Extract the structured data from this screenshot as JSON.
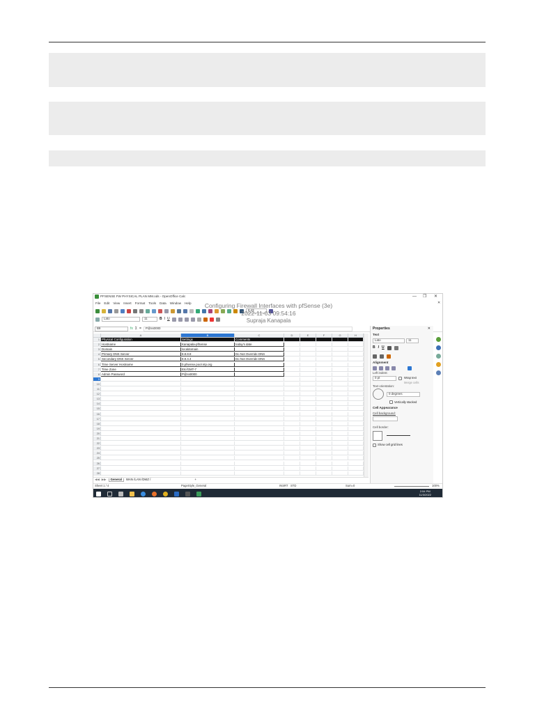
{
  "window": {
    "title": "PFSENSE FW PHYSICAL PLAN MM.ods - OpenOffice Calc",
    "minimize": "—",
    "maximize": "❐",
    "close": "✕",
    "doc_close": "✕"
  },
  "overlay": {
    "line1": "Configuring Firewall Interfaces with pfSense (3e)",
    "line2": "2022-11-03 09:54:16",
    "line3": "Supraja Kanapala"
  },
  "menu": [
    "File",
    "Edit",
    "View",
    "Insert",
    "Format",
    "Tools",
    "Data",
    "Window",
    "Help"
  ],
  "format_toolbar": {
    "font_name": "Lato",
    "font_size": "11",
    "bold": "B",
    "italic": "I",
    "underline": "U",
    "toolbar_size_box": "8.43"
  },
  "formula_bar": {
    "cell_ref": "B9",
    "fx": "fx",
    "sum": "Σ",
    "eq": "=",
    "content": "P@ss0000"
  },
  "grid": {
    "columns": [
      "A",
      "B",
      "C",
      "D",
      "E",
      "F",
      "G",
      "H"
    ],
    "row_numbers": [
      "1",
      "2",
      "3",
      "4",
      "5",
      "6",
      "7",
      "8",
      "9",
      "10",
      "11",
      "12",
      "13",
      "14",
      "15",
      "16",
      "17",
      "18",
      "19",
      "20",
      "21",
      "22",
      "23",
      "24",
      "25",
      "26",
      "27",
      "28"
    ],
    "header_row": [
      "Physical Configuration",
      "Settings",
      "Comments"
    ],
    "rows": [
      [
        "Hostname",
        "Kanapala-pfSense",
        "today's date"
      ],
      [
        "Domain",
        "localdomain",
        ""
      ],
      [
        "Primary DNS Server",
        "8.8.8.8",
        "Do Not Override DNS"
      ],
      [
        "Secondary DNS Server",
        "8.8.4.4",
        "Do Not Override DNS"
      ],
      [
        "Time Server Hostname",
        "0.pfsense.pool.ntp.org",
        ""
      ],
      [
        "Time Zone",
        "Etc/GMT-7",
        ""
      ],
      [
        "Admin Password",
        "P@ss0000",
        ""
      ]
    ]
  },
  "sheet_tabs": {
    "active": "General",
    "others": "WAN /LAN /DMZ /",
    "add": "+"
  },
  "status": {
    "sheet": "Sheet 1 / 4",
    "style": "PageStyle_General",
    "mode": "INSRT",
    "std": "STD",
    "sum": "Sum=0",
    "zoom": "100%"
  },
  "sidebar": {
    "title": "Properties",
    "close": "✕",
    "text_section": "Text",
    "font": "Lato",
    "size": "11",
    "alignment_section": "Alignment",
    "left_indent": "Left indent:",
    "indent_value": "0 pt",
    "wrap_text": "Wrap text",
    "merge_cells": "Merge cells",
    "text_orientation": "Text orientation:",
    "degrees": "0 degrees",
    "vertically_stacked": "Vertically stacked",
    "cell_appearance": "Cell Appearance",
    "cell_background": "Cell background:",
    "cell_border": "Cell border:",
    "show_gridlines": "Show cell grid lines"
  },
  "taskbar": {
    "time": "2:54 PM",
    "date": "11/3/2022"
  },
  "colors": {
    "header_fill": "#111111",
    "selected_row": "#2d77d2",
    "taskbar": "#1f2a36"
  }
}
